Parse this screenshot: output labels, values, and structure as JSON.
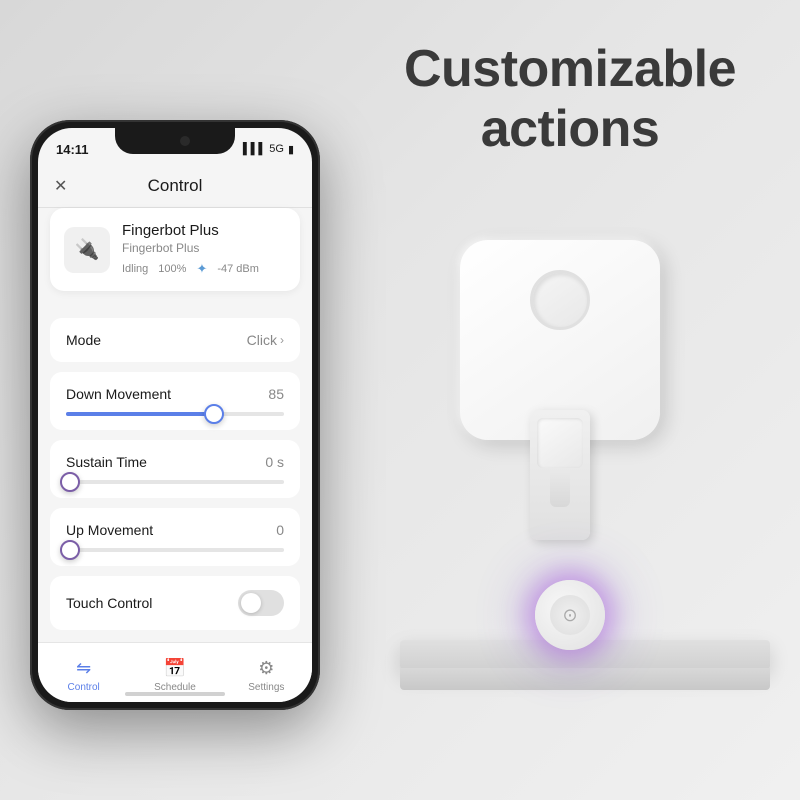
{
  "hero": {
    "title_line1": "Customizable",
    "title_line2": "actions"
  },
  "phone": {
    "status": {
      "time": "14:11",
      "signal": "▌▌▌ 5G",
      "battery": "▮"
    },
    "header": {
      "close": "✕",
      "title": "Control"
    },
    "device": {
      "name": "Fingerbot Plus",
      "model": "Fingerbot Plus",
      "status": "Idling",
      "battery": "100%",
      "bluetooth": "-47 dBm"
    },
    "mode": {
      "label": "Mode",
      "value": "Click",
      "has_chevron": true
    },
    "down_movement": {
      "label": "Down Movement",
      "value": "85",
      "fill_pct": 68,
      "thumb_pct": 68
    },
    "sustain_time": {
      "label": "Sustain Time",
      "value": "0 s",
      "fill_pct": 0,
      "thumb_pct": 0
    },
    "up_movement": {
      "label": "Up Movement",
      "value": "0",
      "fill_pct": 0,
      "thumb_pct": 0
    },
    "touch_control": {
      "label": "Touch Control",
      "enabled": false
    },
    "nav": {
      "control": "Control",
      "schedule": "Schedule",
      "settings": "Settings"
    }
  }
}
